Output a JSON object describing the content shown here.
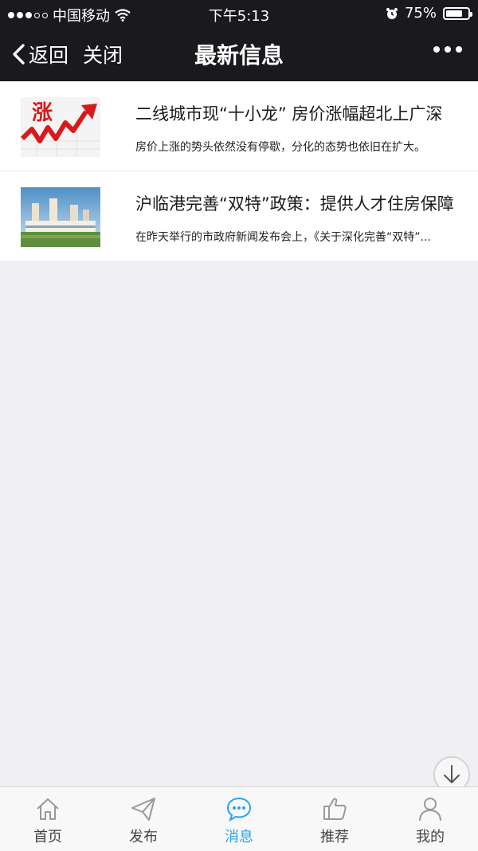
{
  "status_bar": {
    "carrier": "中国移动",
    "time": "下午5:13",
    "battery_percent": "75%",
    "battery_level": 0.75
  },
  "nav": {
    "back_label": "返回",
    "close_label": "关闭",
    "title": "最新信息"
  },
  "news": [
    {
      "thumb_text": "涨",
      "title": "二线城市现“十小龙” 房价涨幅超北上广深",
      "desc": "房价上涨的势头依然没有停歇，分化的态势也依旧在扩大。"
    },
    {
      "title": "沪临港完善“双特”政策：提供人才住房保障",
      "desc": "在昨天举行的市政府新闻发布会上，《关于深化完善“双特”..."
    }
  ],
  "tabbar": {
    "items": [
      {
        "label": "首页",
        "icon": "home-icon"
      },
      {
        "label": "发布",
        "icon": "send-icon"
      },
      {
        "label": "消息",
        "icon": "chat-icon",
        "active": true
      },
      {
        "label": "推荐",
        "icon": "thumbs-up-icon"
      },
      {
        "label": "我的",
        "icon": "user-icon"
      }
    ]
  },
  "colors": {
    "header_bg": "#1a1a1e",
    "page_bg": "#efeff4",
    "accent": "#28a3ef"
  }
}
